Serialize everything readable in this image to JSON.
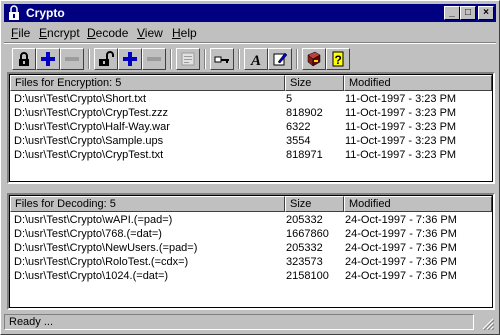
{
  "window": {
    "title": "Crypto",
    "controls": {
      "minimize": "_",
      "maximize": "□",
      "close": "×"
    }
  },
  "menu": {
    "items": [
      {
        "label": "File",
        "mnemonic": "F",
        "rest": "ile"
      },
      {
        "label": "Encrypt",
        "mnemonic": "E",
        "rest": "ncrypt"
      },
      {
        "label": "Decode",
        "mnemonic": "D",
        "rest": "ecode"
      },
      {
        "label": "View",
        "mnemonic": "V",
        "rest": "iew"
      },
      {
        "label": "Help",
        "mnemonic": "H",
        "rest": "elp"
      }
    ]
  },
  "toolbar": {
    "buttons": [
      "lock-icon",
      "add-icon",
      "remove-icon",
      "unlock-icon",
      "add-icon",
      "remove-icon",
      "properties-icon",
      "key-icon",
      "font-icon",
      "edit-icon",
      "book-icon",
      "help-icon"
    ]
  },
  "encryption": {
    "header": {
      "name": "Files for Encryption: 5",
      "size": "Size",
      "modified": "Modified"
    },
    "rows": [
      {
        "name": "D:\\usr\\Test\\Crypto\\Short.txt",
        "size": "5",
        "modified": "11-Oct-1997 - 3:23 PM"
      },
      {
        "name": "D:\\usr\\Test\\Crypto\\CrypTest.zzz",
        "size": "818902",
        "modified": "11-Oct-1997 - 3:23 PM"
      },
      {
        "name": "D:\\usr\\Test\\Crypto\\Half-Way.war",
        "size": "6322",
        "modified": "11-Oct-1997 - 3:23 PM"
      },
      {
        "name": "D:\\usr\\Test\\Crypto\\Sample.ups",
        "size": "3554",
        "modified": "11-Oct-1997 - 3:23 PM"
      },
      {
        "name": "D:\\usr\\Test\\Crypto\\CrypTest.txt",
        "size": "818971",
        "modified": "11-Oct-1997 - 3:23 PM"
      }
    ]
  },
  "decoding": {
    "header": {
      "name": "Files for Decoding: 5",
      "size": "Size",
      "modified": "Modified"
    },
    "rows": [
      {
        "name": "D:\\usr\\Test\\Crypto\\wAPI.(=pad=)",
        "size": "205332",
        "modified": "24-Oct-1997 - 7:36 PM"
      },
      {
        "name": "D:\\usr\\Test\\Crypto\\768.(=dat=)",
        "size": "1667860",
        "modified": "24-Oct-1997 - 7:36 PM"
      },
      {
        "name": "D:\\usr\\Test\\Crypto\\NewUsers.(=pad=)",
        "size": "205332",
        "modified": "24-Oct-1997 - 7:36 PM"
      },
      {
        "name": "D:\\usr\\Test\\Crypto\\RoloTest.(=cdx=)",
        "size": "323573",
        "modified": "24-Oct-1997 - 7:36 PM"
      },
      {
        "name": "D:\\usr\\Test\\Crypto\\1024.(=dat=)",
        "size": "2158100",
        "modified": "24-Oct-1997 - 7:36 PM"
      }
    ]
  },
  "status": {
    "text": "Ready ..."
  },
  "colors": {
    "titlebar": "#000080",
    "face": "#c0c0c0",
    "accent_blue": "#0000c0",
    "book": "#8b1a1a",
    "help": "#ffff00"
  }
}
